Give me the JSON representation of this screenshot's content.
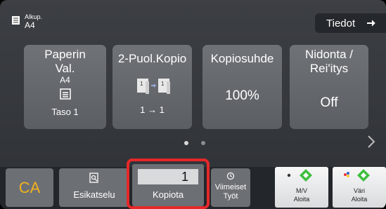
{
  "header": {
    "original_label": "Alkup.",
    "original_size": "A4",
    "info_button": "Tiedot"
  },
  "tiles": {
    "paper": {
      "title": "Paperin Val.",
      "size": "A4",
      "tray": "Taso 1"
    },
    "duplex": {
      "title": "2-Puol.Kopio",
      "mode": "1 → 1"
    },
    "ratio": {
      "title": "Kopiosuhde",
      "value": "100%"
    },
    "staple": {
      "title": "Nidonta / Rei'itys",
      "value": "Off"
    }
  },
  "pager": {
    "pages": 2,
    "current": 1
  },
  "bottom": {
    "ca_label": "CA",
    "preview_label": "Esikatselu",
    "copies_value": "1",
    "copies_label": "Kopiota",
    "jobs_label_1": "Viimeiset",
    "jobs_label_2": "Työt",
    "bw_line1": "M/V",
    "bw_line2": "Aloita",
    "color_line1": "Väri",
    "color_line2": "Aloita"
  },
  "colors": {
    "accent_highlight": "#e5282a",
    "ca_text": "#f0b020",
    "start_icon_green": "#3fbf3f"
  }
}
